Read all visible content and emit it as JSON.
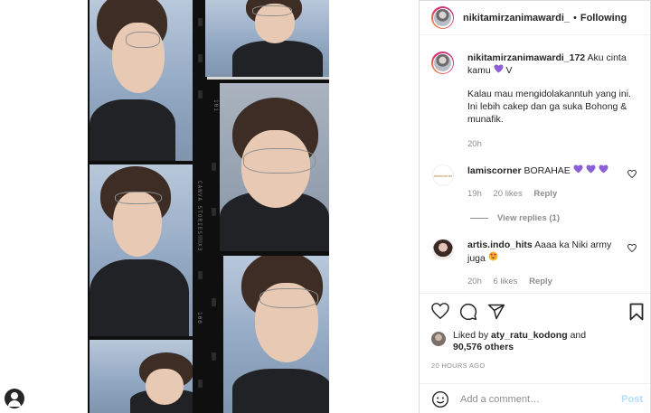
{
  "header": {
    "username": "nikitamirzanimawardi_",
    "separator": "•",
    "follow_label": "Following"
  },
  "caption": {
    "username": "nikitamirzanimawardi_172",
    "text_line1": "Aku cinta kamu",
    "text_suffix": "V",
    "paragraph": "Kalau mau mengidolakanntuh yang ini. Ini lebih cakep dan ga suka Bohong & munafik.",
    "time": "20h"
  },
  "comments": [
    {
      "username": "lamiscorner",
      "text": "BORAHAE",
      "avatar_text": "lamiscorner",
      "time": "19h",
      "likes": "20 likes",
      "reply": "Reply",
      "view_replies": "View replies (1)"
    },
    {
      "username": "artis.indo_hits",
      "text": "Aaaa ka Niki army juga",
      "time": "20h",
      "likes": "6 likes",
      "reply": "Reply"
    }
  ],
  "likes": {
    "prefix": "Liked by",
    "user": "aty_ratu_kodong",
    "conj": "and",
    "count": "90,576 others"
  },
  "timestamp": "20 HOURS AGO",
  "add_comment": {
    "placeholder": "Add a comment…",
    "post_label": "Post"
  },
  "film_text": {
    "a": "CANVA STORIES FX3",
    "b": "100",
    "c": "101"
  },
  "colors": {
    "heart_purple": "#8b5fd6",
    "link_blue": "#b2dffc",
    "muted": "#8e8e8e"
  }
}
